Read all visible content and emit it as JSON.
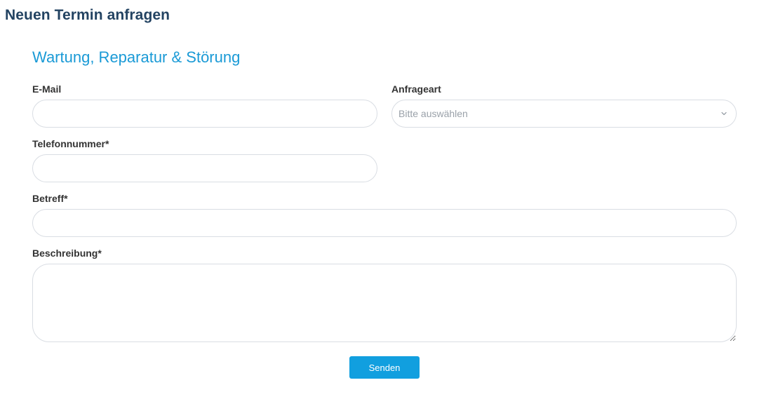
{
  "page": {
    "title": "Neuen Termin anfragen"
  },
  "form": {
    "section_title": "Wartung, Reparatur & Störung",
    "email": {
      "label": "E-Mail",
      "value": "",
      "placeholder": ""
    },
    "request_type": {
      "label": "Anfrageart",
      "selected": "Bitte auswählen",
      "icon": "chevron-down-icon"
    },
    "phone": {
      "label": "Telefonnummer*",
      "value": "",
      "placeholder": ""
    },
    "subject": {
      "label": "Betreff*",
      "value": "",
      "placeholder": ""
    },
    "description": {
      "label": "Beschreibung*",
      "value": "",
      "placeholder": ""
    },
    "submit_label": "Senden"
  },
  "colors": {
    "title": "#234362",
    "accent": "#1a9ad6",
    "button": "#119fdf",
    "border": "#d9dde3"
  }
}
